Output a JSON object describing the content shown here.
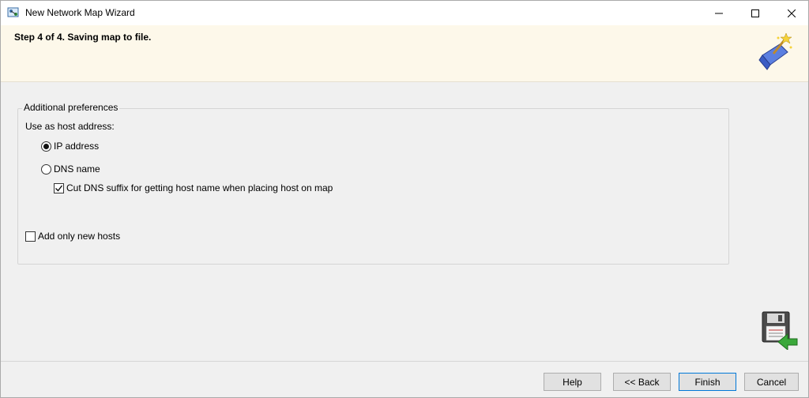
{
  "window": {
    "title": "New Network Map Wizard"
  },
  "header": {
    "step_title": "Step 4 of 4. Saving map to file."
  },
  "preferences": {
    "group_label": "Additional preferences",
    "host_address_label": "Use as host address:",
    "option_ip": "IP address",
    "option_dns": "DNS name",
    "selected_option": "IP address",
    "cut_dns_label": "Cut DNS suffix for getting host name when placing host on map",
    "cut_dns_checked": true,
    "add_new_label": "Add only new hosts",
    "add_new_checked": false
  },
  "buttons": {
    "help": "Help",
    "back": "<< Back",
    "finish": "Finish",
    "cancel": "Cancel"
  },
  "icons": {
    "app": "network-map-icon",
    "header": "wizard-wand-icon",
    "save": "floppy-save-icon"
  }
}
